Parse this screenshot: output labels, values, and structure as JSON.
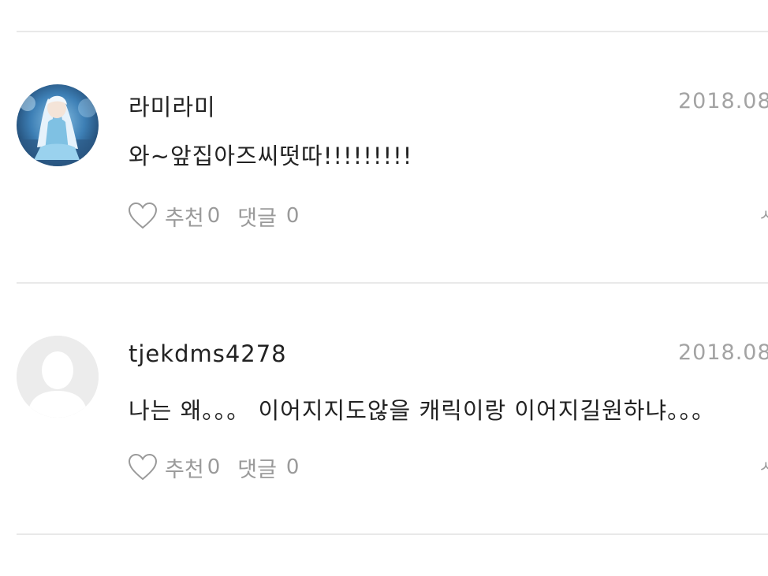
{
  "comments": [
    {
      "nickname": "라미라미",
      "date": "2018.08",
      "text": "와~앞집아즈씨떳따!!!!!!!!!",
      "like_label": "추천",
      "like_count": "0",
      "reply_label": "댓글",
      "reply_count": "0",
      "more": "ㅅ",
      "avatar": "anime-character-avatar"
    },
    {
      "nickname": "tjekdms4278",
      "date": "2018.08",
      "text": "나는 왜。。。 이어지지도않을 캐릭이랑 이어지길원하냐。。。",
      "like_label": "추천",
      "like_count": "0",
      "reply_label": "댓글",
      "reply_count": "0",
      "more": "ㅅ",
      "avatar": "default-user-avatar"
    }
  ],
  "icons": {
    "like": "heart-outline-icon"
  },
  "colors": {
    "divider": "#e9e9e9",
    "text": "#222222",
    "muted": "#9a9a9a",
    "default_avatar": "#ececec"
  }
}
